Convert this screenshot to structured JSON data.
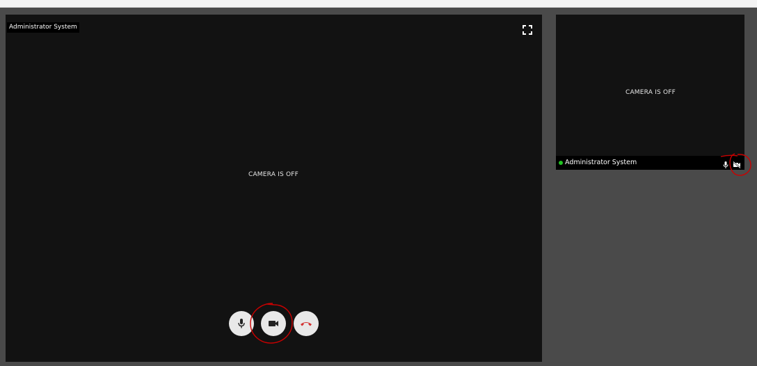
{
  "main": {
    "participant_name": "Administrator System",
    "camera_status": "CAMERA IS OFF",
    "icons": {
      "fullscreen": "fullscreen-icon",
      "mic": "mic-icon",
      "camera": "video-camera-icon",
      "hangup": "phone-hangup-icon"
    }
  },
  "self_view": {
    "camera_status": "CAMERA IS OFF",
    "participant_name": "Administrator System",
    "status_color": "#21c321",
    "icons": {
      "mic": "mic-icon",
      "camera": "camera-off-icon"
    }
  },
  "colors": {
    "page_bg": "#4a4a4a",
    "tile_bg": "#121212",
    "hangup": "#d32f2f",
    "annotation": "#cc0000"
  }
}
